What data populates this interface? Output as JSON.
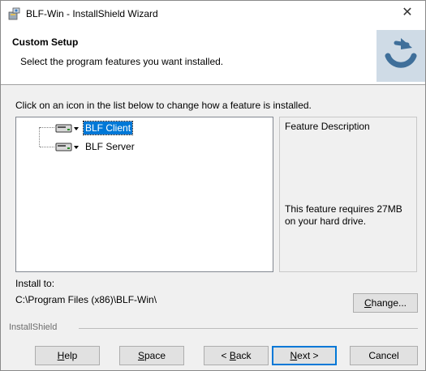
{
  "window": {
    "title": "BLF-Win - InstallShield Wizard",
    "close_glyph": "✕"
  },
  "header": {
    "title": "Custom Setup",
    "subtitle": "Select the program features you want installed.",
    "logo_icon": "installshield-logo-icon"
  },
  "instruction": "Click on an icon in the list below to change how a feature is installed.",
  "features": [
    {
      "label": "BLF Client",
      "selected": true,
      "icon": "hard-drive-dropdown-icon"
    },
    {
      "label": "BLF Server",
      "selected": false,
      "icon": "hard-drive-dropdown-icon"
    }
  ],
  "description": {
    "title": "Feature Description",
    "text": "This feature requires 27MB on your hard drive."
  },
  "install": {
    "label": "Install to:",
    "path": "C:\\Program Files (x86)\\BLF-Win\\"
  },
  "buttons": {
    "change": {
      "pre": "",
      "acc": "C",
      "post": "hange..."
    },
    "help": {
      "pre": "",
      "acc": "H",
      "post": "elp"
    },
    "space": {
      "pre": "",
      "acc": "S",
      "post": "pace"
    },
    "back": {
      "pre": "< ",
      "acc": "B",
      "post": "ack"
    },
    "next": {
      "pre": "",
      "acc": "N",
      "post": "ext >"
    },
    "cancel": {
      "label": "Cancel"
    }
  },
  "brand": "InstallShield",
  "colors": {
    "selection": "#0078d7",
    "window_bg": "#f0f0f0",
    "logo_blue": "#3f6f9a"
  }
}
